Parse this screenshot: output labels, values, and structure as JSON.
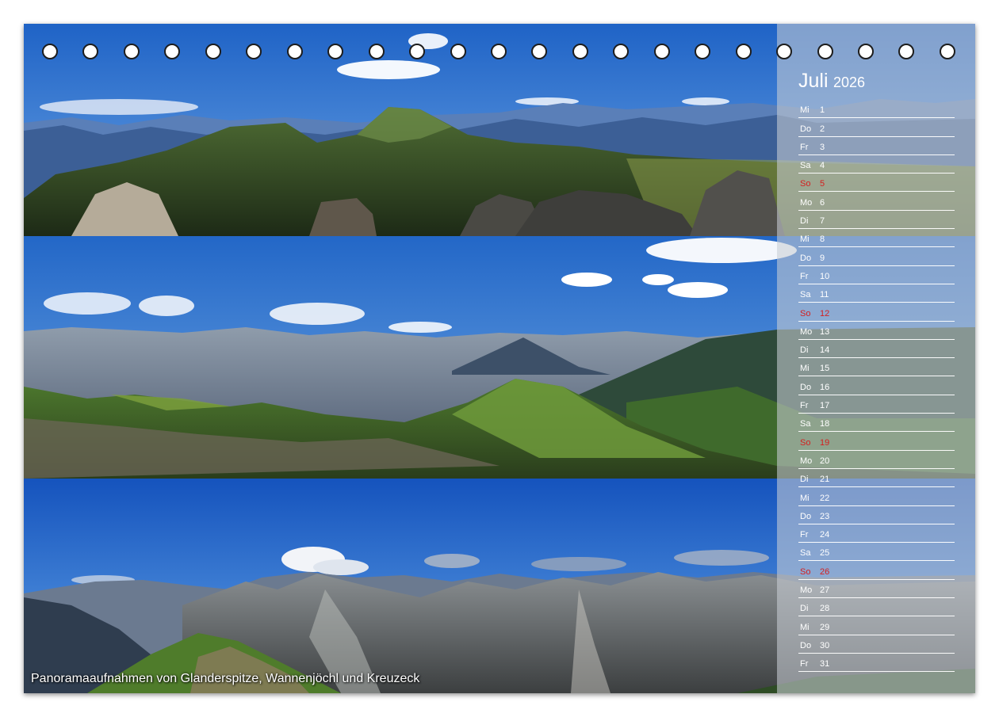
{
  "calendar": {
    "month": "Juli",
    "year": "2026",
    "caption": "Panoramaaufnahmen von Glanderspitze, Wannenjöchl und Kreuzeck",
    "weekend_color": "#d42020",
    "text_color": "#ffffff",
    "ring_count": 23,
    "days": [
      {
        "dn": "Mi",
        "dd": "1",
        "sunday": false
      },
      {
        "dn": "Do",
        "dd": "2",
        "sunday": false
      },
      {
        "dn": "Fr",
        "dd": "3",
        "sunday": false
      },
      {
        "dn": "Sa",
        "dd": "4",
        "sunday": false
      },
      {
        "dn": "So",
        "dd": "5",
        "sunday": true
      },
      {
        "dn": "Mo",
        "dd": "6",
        "sunday": false
      },
      {
        "dn": "Di",
        "dd": "7",
        "sunday": false
      },
      {
        "dn": "Mi",
        "dd": "8",
        "sunday": false
      },
      {
        "dn": "Do",
        "dd": "9",
        "sunday": false
      },
      {
        "dn": "Fr",
        "dd": "10",
        "sunday": false
      },
      {
        "dn": "Sa",
        "dd": "11",
        "sunday": false
      },
      {
        "dn": "So",
        "dd": "12",
        "sunday": true
      },
      {
        "dn": "Mo",
        "dd": "13",
        "sunday": false
      },
      {
        "dn": "Di",
        "dd": "14",
        "sunday": false
      },
      {
        "dn": "Mi",
        "dd": "15",
        "sunday": false
      },
      {
        "dn": "Do",
        "dd": "16",
        "sunday": false
      },
      {
        "dn": "Fr",
        "dd": "17",
        "sunday": false
      },
      {
        "dn": "Sa",
        "dd": "18",
        "sunday": false
      },
      {
        "dn": "So",
        "dd": "19",
        "sunday": true
      },
      {
        "dn": "Mo",
        "dd": "20",
        "sunday": false
      },
      {
        "dn": "Di",
        "dd": "21",
        "sunday": false
      },
      {
        "dn": "Mi",
        "dd": "22",
        "sunday": false
      },
      {
        "dn": "Do",
        "dd": "23",
        "sunday": false
      },
      {
        "dn": "Fr",
        "dd": "24",
        "sunday": false
      },
      {
        "dn": "Sa",
        "dd": "25",
        "sunday": false
      },
      {
        "dn": "So",
        "dd": "26",
        "sunday": true
      },
      {
        "dn": "Mo",
        "dd": "27",
        "sunday": false
      },
      {
        "dn": "Di",
        "dd": "28",
        "sunday": false
      },
      {
        "dn": "Mi",
        "dd": "29",
        "sunday": false
      },
      {
        "dn": "Do",
        "dd": "30",
        "sunday": false
      },
      {
        "dn": "Fr",
        "dd": "31",
        "sunday": false
      }
    ]
  }
}
